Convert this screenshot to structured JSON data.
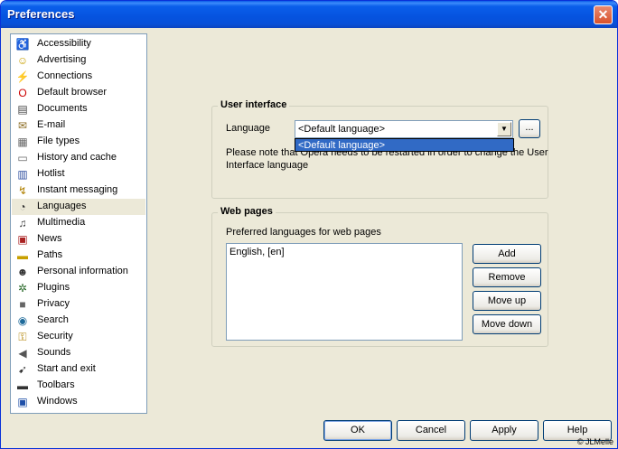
{
  "window": {
    "title": "Preferences",
    "close_glyph": "✕"
  },
  "categories": [
    {
      "label": "Accessibility",
      "icon": "wheelchair-icon",
      "glyph": "♿",
      "color": "#1E4FA8"
    },
    {
      "label": "Advertising",
      "icon": "smiley-icon",
      "glyph": "☺",
      "color": "#C8A000"
    },
    {
      "label": "Connections",
      "icon": "plug-icon",
      "glyph": "⚡",
      "color": "#555555"
    },
    {
      "label": "Default browser",
      "icon": "opera-icon",
      "glyph": "O",
      "color": "#CC0000"
    },
    {
      "label": "Documents",
      "icon": "document-icon",
      "glyph": "▤",
      "color": "#444444"
    },
    {
      "label": "E-mail",
      "icon": "envelope-icon",
      "glyph": "✉",
      "color": "#8A6A20"
    },
    {
      "label": "File types",
      "icon": "file-types-icon",
      "glyph": "▦",
      "color": "#666666"
    },
    {
      "label": "History and cache",
      "icon": "drive-icon",
      "glyph": "▭",
      "color": "#666666"
    },
    {
      "label": "Hotlist",
      "icon": "hotlist-icon",
      "glyph": "▥",
      "color": "#3050A0"
    },
    {
      "label": "Instant messaging",
      "icon": "lightning-icon",
      "glyph": "↯",
      "color": "#B08000"
    },
    {
      "label": "Languages",
      "icon": "languages-icon",
      "glyph": "◔",
      "color": "#333333"
    },
    {
      "label": "Multimedia",
      "icon": "multimedia-icon",
      "glyph": "♫",
      "color": "#333333"
    },
    {
      "label": "News",
      "icon": "news-icon",
      "glyph": "▣",
      "color": "#AA2222"
    },
    {
      "label": "Paths",
      "icon": "folder-icon",
      "glyph": "▬",
      "color": "#C8A000"
    },
    {
      "label": "Personal information",
      "icon": "person-icon",
      "glyph": "☻",
      "color": "#333333"
    },
    {
      "label": "Plugins",
      "icon": "plugins-icon",
      "glyph": "✲",
      "color": "#2A6A2A"
    },
    {
      "label": "Privacy",
      "icon": "privacy-icon",
      "glyph": "■",
      "color": "#666666"
    },
    {
      "label": "Search",
      "icon": "search-icon",
      "glyph": "◉",
      "color": "#1E6A9A"
    },
    {
      "label": "Security",
      "icon": "keys-icon",
      "glyph": "⚿",
      "color": "#B08000"
    },
    {
      "label": "Sounds",
      "icon": "speaker-icon",
      "glyph": "◀",
      "color": "#555555"
    },
    {
      "label": "Start and exit",
      "icon": "start-exit-icon",
      "glyph": "➹",
      "color": "#333333"
    },
    {
      "label": "Toolbars",
      "icon": "toolbar-icon",
      "glyph": "▬",
      "color": "#333333"
    },
    {
      "label": "Windows",
      "icon": "windows-icon",
      "glyph": "▣",
      "color": "#1E4FA8"
    }
  ],
  "selected_category": "Languages",
  "user_interface": {
    "heading": "User interface",
    "language_label": "Language",
    "language_value": "<Default language>",
    "browse_label": "...",
    "dropdown_option": "<Default language>",
    "note_line1": "Please note that Opera needs to be restarted in order to change the User",
    "note_line2": "Interface language"
  },
  "web_pages": {
    "heading": "Web pages",
    "preferred_label": "Preferred languages for web pages",
    "languages": [
      "English, [en]"
    ],
    "add": "Add",
    "remove": "Remove",
    "move_up": "Move up",
    "move_down": "Move down"
  },
  "footer": {
    "ok": "OK",
    "cancel": "Cancel",
    "apply": "Apply",
    "help": "Help"
  },
  "copyright": "© JLMelle"
}
